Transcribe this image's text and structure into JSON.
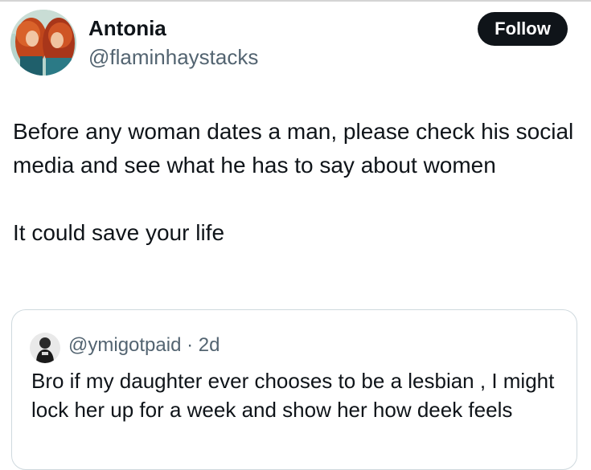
{
  "author": {
    "display_name": "Antonia",
    "handle": "@flaminhaystacks",
    "avatar_icon": "profile-avatar-redhead"
  },
  "follow_button": {
    "label": "Follow"
  },
  "tweet": {
    "text": "Before any woman dates a man, please check his social media and see what he has to say about women\n\nIt could save your life"
  },
  "quoted_tweet": {
    "handle": "@ymigotpaid",
    "separator": "·",
    "time": "2d",
    "avatar_icon": "profile-avatar-dark",
    "text": "Bro if my daughter ever chooses to be a lesbian , I might lock her up for a week and show her how deek feels"
  },
  "colors": {
    "text": "#0f1419",
    "secondary": "#536471",
    "border": "#cfd9de",
    "button_bg": "#0f1419",
    "button_text": "#ffffff"
  }
}
